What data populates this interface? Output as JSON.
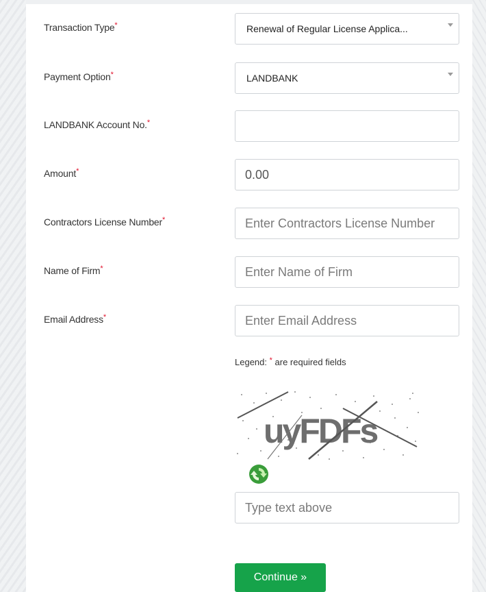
{
  "form": {
    "required_marker": "*",
    "transaction_type": {
      "label": "Transaction Type",
      "value": "Renewal of Regular License Applica..."
    },
    "payment_option": {
      "label": "Payment Option",
      "value": "LANDBANK"
    },
    "landbank_account": {
      "label": "LANDBANK Account No.",
      "value": ""
    },
    "amount": {
      "label": "Amount",
      "value": "0.00"
    },
    "license_number": {
      "label": "Contractors License Number",
      "placeholder": "Enter Contractors License Number"
    },
    "firm_name": {
      "label": "Name of Firm",
      "placeholder": "Enter Name of Firm"
    },
    "email": {
      "label": "Email Address",
      "placeholder": "Enter Email Address"
    },
    "legend_prefix": "Legend:",
    "legend_suffix": "are required fields",
    "captcha_text": "uyFDFs",
    "captcha_input_placeholder": "Type text above",
    "continue_label": "Continue »"
  },
  "colors": {
    "required": "#e0112b",
    "button": "#16a34a"
  }
}
